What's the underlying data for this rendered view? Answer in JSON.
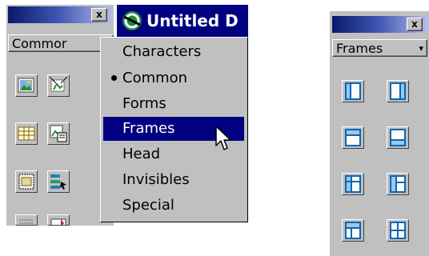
{
  "left_panel": {
    "close_label": "x",
    "category_select": {
      "value": "Commor",
      "arrow": "▾"
    }
  },
  "document_window": {
    "title": "Untitled D"
  },
  "category_menu": {
    "items": [
      {
        "label": "Characters",
        "checked": false,
        "selected": false
      },
      {
        "label": "Common",
        "checked": true,
        "selected": false
      },
      {
        "label": "Forms",
        "checked": false,
        "selected": false
      },
      {
        "label": "Frames",
        "checked": false,
        "selected": true
      },
      {
        "label": "Head",
        "checked": false,
        "selected": false
      },
      {
        "label": "Invisibles",
        "checked": false,
        "selected": false
      },
      {
        "label": "Special",
        "checked": false,
        "selected": false
      }
    ]
  },
  "right_panel": {
    "close_label": "x",
    "category_select": {
      "value": "Frames",
      "arrow": "▾"
    },
    "frame_buttons": [
      {
        "icon": "frame-left-icon"
      },
      {
        "icon": "frame-right-icon"
      },
      {
        "icon": "frame-top-icon"
      },
      {
        "icon": "frame-bottom-icon"
      },
      {
        "icon": "frame-left-top-icon"
      },
      {
        "icon": "frame-left-top-nested-icon"
      },
      {
        "icon": "frame-top-left-icon"
      },
      {
        "icon": "frame-split-icon"
      }
    ]
  },
  "colors": {
    "menu_highlight": "#000080",
    "panel_gray": "#c0c0c0",
    "frame_icon": "#0a66b4"
  }
}
